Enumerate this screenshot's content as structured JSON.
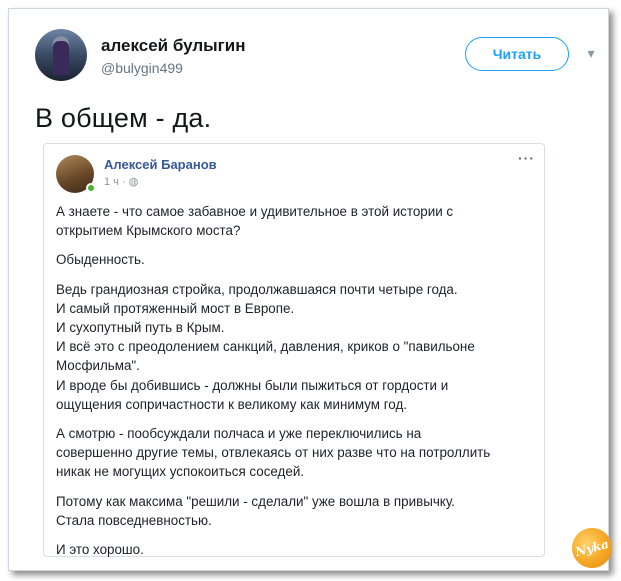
{
  "tweet": {
    "author_name": "алексей булыгин",
    "handle": "@bulygin499",
    "follow_label": "Читать",
    "chevron": "▾",
    "text": "В общем - да."
  },
  "fb_post": {
    "author_name": "Алексей Баранов",
    "meta": "1 ч · ",
    "more": "···",
    "paragraphs": [
      [
        "А знаете - что самое забавное и удивительное в этой истории с",
        "открытием Крымского моста?"
      ],
      [
        "Обыденность."
      ],
      [
        "Ведь грандиозная стройка, продолжавшаяся почти четыре года.",
        "И самый протяженный мост в Европе.",
        "И сухопутный путь в Крым.",
        "И всё это с преодолением санкций, давления, криков о \"павильоне",
        "Мосфильма\".",
        "И вроде бы добившись - должны были пыжиться от гордости и",
        "ощущения сопричастности к великому как минимум год."
      ],
      [
        "А смотрю - пообсуждали полчаса и уже переключились на",
        "совершенно другие темы, отвлекаясь от них разве что на потроллить",
        "никак не могущих успокоиться соседей."
      ],
      [
        "Потому как максима \"решили - сделали\" уже вошла в привычку.",
        "Стала повседневностью."
      ],
      [
        "И это хорошо."
      ]
    ]
  },
  "watermark": "Nyka",
  "icons": {
    "globe": "◍",
    "chevron": "chevron-down-icon"
  }
}
